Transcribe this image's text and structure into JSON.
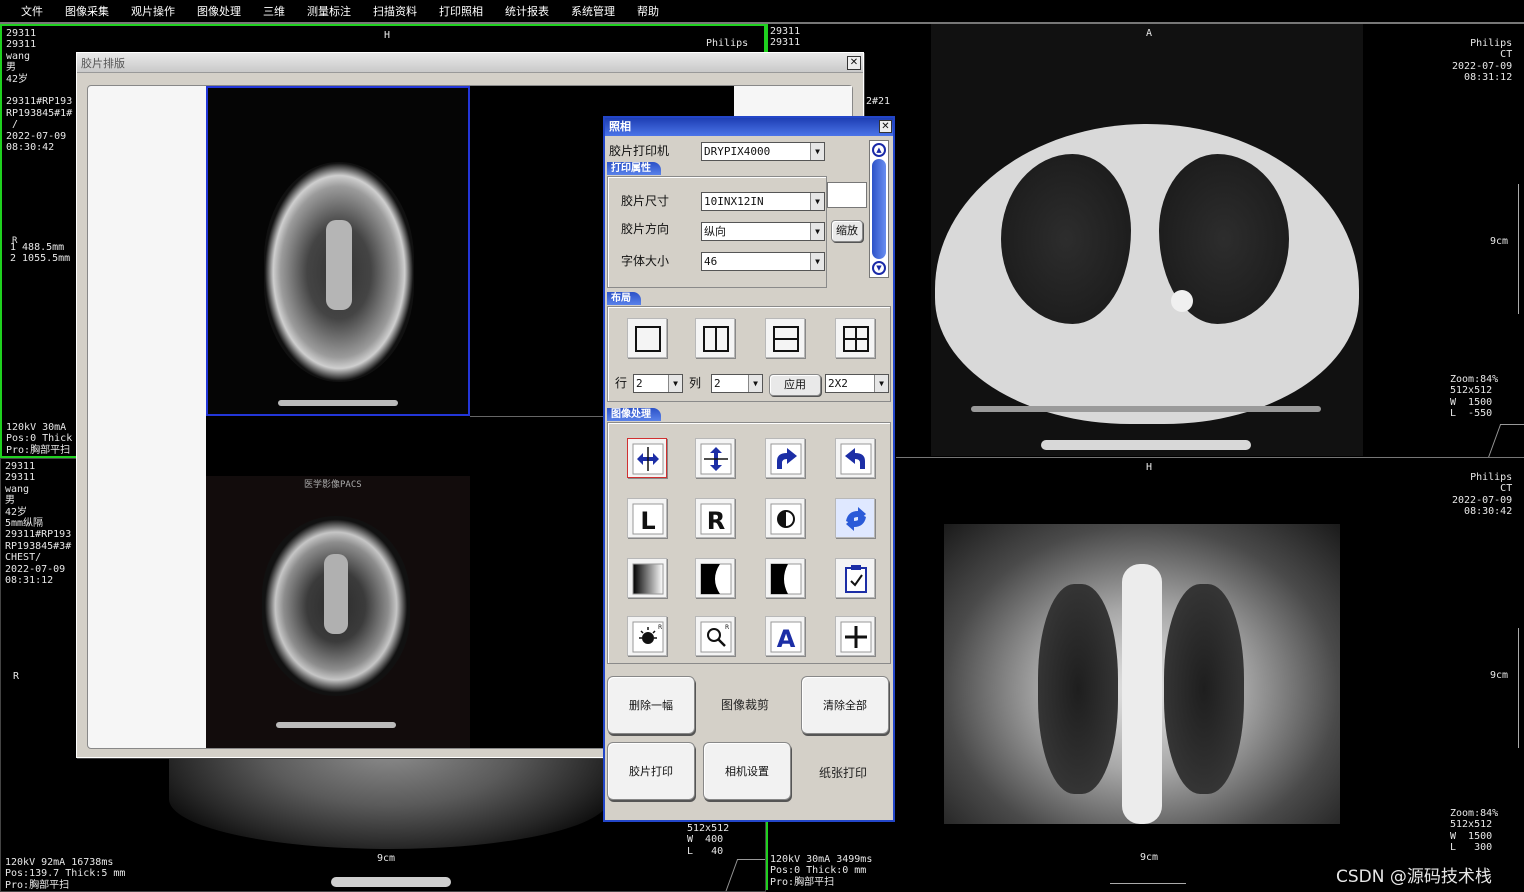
{
  "menu": [
    "文件",
    "图像采集",
    "观片操作",
    "图像处理",
    "三维",
    "测量标注",
    "扫描资料",
    "打印照相",
    "统计报表",
    "系统管理",
    "帮助"
  ],
  "viewport_tl": {
    "info": "29311\n29311\nwang\n男\n42岁\n\n29311#RP193\nRP193845#1#\n /\n2022-07-09\n08:30:42",
    "orient_top": "H",
    "maker": "Philips",
    "measure": "1 488.5mm\n2 1055.5mm",
    "measure_mark": "R",
    "bottom": "120kV 30mA\nPos:0 Thick\nPro:胸部平扫"
  },
  "viewport_ml": {
    "info": "29311\n29311\nwang\n男\n42岁\n5mm纵隔\n29311#RP193\nRP193845#3#\nCHEST/\n2022-07-09\n08:31:12",
    "orient": "R",
    "bottom": "120kV 92mA 16738ms\nPos:139.7 Thick:5 mm\nPro:胸部平扫",
    "wl": "512x512\nW  400\nL   40",
    "scale": "9cm"
  },
  "viewport_mid": {
    "info": "29311\n29311",
    "counter": "2#21",
    "bottom": "120kV 30mA 3499ms\nPos:0 Thick:0 mm\nPro:胸部平扫"
  },
  "viewport_tr": {
    "orient_top": "A",
    "maker": "Philips\nCT\n2022-07-09\n08:31:12",
    "scale": "9cm",
    "zoom": "Zoom:84%\n512x512\nW  1500\nL  -550"
  },
  "viewport_br": {
    "orient_top": "H",
    "maker": "Philips\nCT\n2022-07-09\n08:30:42",
    "scale_right": "9cm",
    "scale_bottom": "9cm",
    "zoom": "Zoom:84%\n512x512\nW  1500\nL   300"
  },
  "film_dialog": {
    "title": "胶片排版",
    "thumb2_watermark": "医学影像PACS"
  },
  "photo_dialog": {
    "title": "照相",
    "printer_label": "胶片打印机",
    "printer_value": "DRYPIX4000",
    "print_props_tab": "打印属性",
    "size_label": "胶片尺寸",
    "size_value": "10INX12IN",
    "orient_label": "胶片方向",
    "orient_value": "纵向",
    "font_label": "字体大小",
    "font_value": "46",
    "zoom_button": "缩放",
    "layout_tab": "布局",
    "row_label": "行",
    "row_value": "2",
    "col_label": "列",
    "col_value": "2",
    "apply_button": "应用",
    "grid_value": "2X2",
    "imgproc_tab": "图像处理",
    "delete_one": "删除一幅",
    "crop": "图像裁剪",
    "clear_all": "清除全部",
    "film_print": "胶片打印",
    "camera_settings": "相机设置",
    "paper_print": "纸张打印"
  },
  "watermark": "CSDN @源码技术栈"
}
